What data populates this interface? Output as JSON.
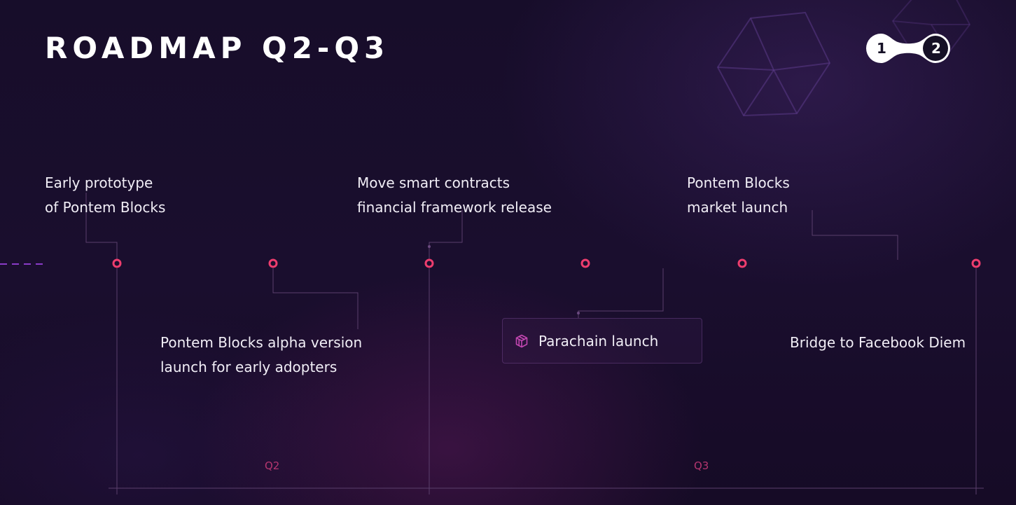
{
  "title": "ROADMAP Q2-Q3",
  "pager": {
    "first": "1",
    "second": "2"
  },
  "milestones": {
    "early_prototype": [
      "Early prototype",
      "of Pontem Blocks"
    ],
    "move_contracts": [
      "Move smart contracts",
      "financial framework release"
    ],
    "market_launch": [
      "Pontem Blocks",
      "market launch"
    ],
    "alpha_version": [
      "Pontem Blocks alpha version",
      "launch for early adopters"
    ],
    "parachain": "Parachain launch",
    "bridge": "Bridge to Facebook Diem"
  },
  "quarters": {
    "q2": "Q2",
    "q3": "Q3"
  },
  "colors": {
    "timeline_start": "#8a3bc8",
    "timeline_end": "#ee3d6e",
    "node": "#ee3d6e",
    "quarter_label": "#b5366f",
    "connector": "#5a3f6c"
  },
  "icons": {
    "parachain": "polkadot-cube-icon",
    "decor": "wireframe-cube-icon"
  }
}
